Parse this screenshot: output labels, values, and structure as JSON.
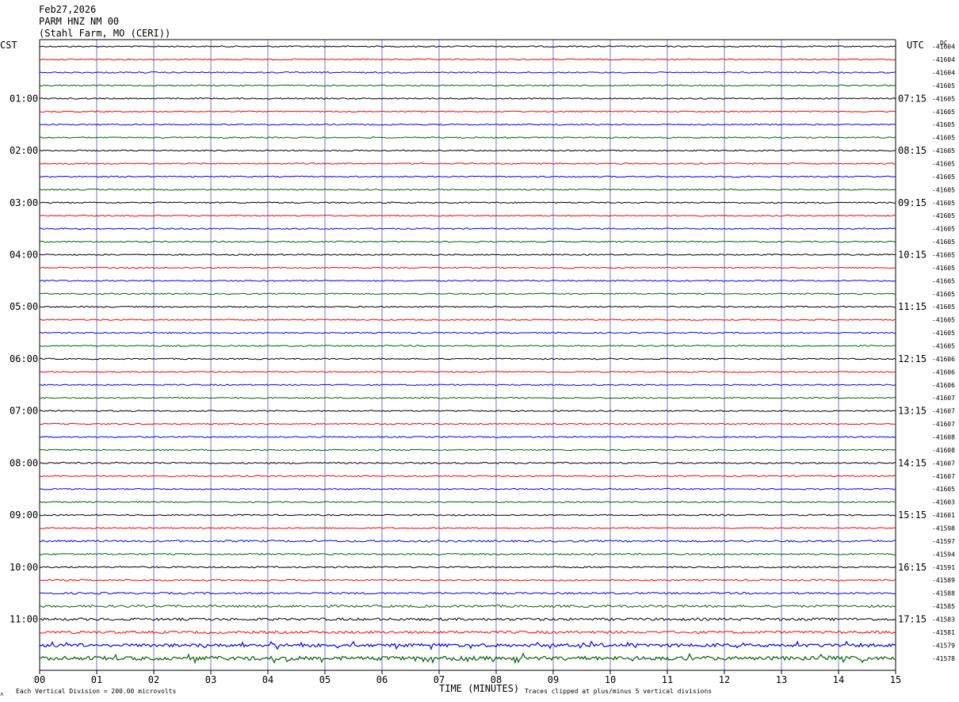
{
  "header": {
    "date": "Feb27,2026",
    "station": "PARM HNZ NM 00",
    "location": "(Stahl Farm, MO (CERI))"
  },
  "left_tz": "CST",
  "right_tz": "UTC",
  "dc_label": "DC",
  "footer": {
    "scale_note": "Each Vertical Division =  200.00 microvolts",
    "xlabel": "TIME (MINUTES)",
    "clip_note": "Traces clipped at plus/minus 5 vertical divisions",
    "corner_mark": "˄"
  },
  "colors": {
    "trace_cycle": [
      "#000000",
      "#ff0000",
      "#0000ff",
      "#006400"
    ],
    "grid_vertical": "#7777bb",
    "frame": "#000000"
  },
  "chart_data": {
    "type": "line",
    "title": "PARM HNZ NM 00",
    "xlabel": "TIME (MINUTES)",
    "xlim": [
      0,
      15
    ],
    "x_ticks": [
      "00",
      "01",
      "02",
      "03",
      "04",
      "05",
      "06",
      "07",
      "08",
      "09",
      "10",
      "11",
      "12",
      "13",
      "14",
      "15"
    ],
    "trace_count": 48,
    "left_hour_labels": [
      "01:00",
      "02:00",
      "03:00",
      "04:00",
      "05:00",
      "06:00",
      "07:00",
      "08:00",
      "09:00",
      "10:00",
      "11:00"
    ],
    "right_hour_labels": [
      "07:15",
      "08:15",
      "09:15",
      "10:15",
      "11:15",
      "12:15",
      "13:15",
      "14:15",
      "15:15",
      "16:15",
      "17:15"
    ],
    "dc_offsets": [
      "-41604",
      "-41604",
      "-41604",
      "-41605",
      "-41605",
      "-41605",
      "-41605",
      "-41605",
      "-41605",
      "-41605",
      "-41605",
      "-41605",
      "-41605",
      "-41605",
      "-41605",
      "-41605",
      "-41605",
      "-41605",
      "-41605",
      "-41605",
      "-41605",
      "-41605",
      "-41605",
      "-41605",
      "-41606",
      "-41606",
      "-41606",
      "-41607",
      "-41607",
      "-41607",
      "-41608",
      "-41608",
      "-41607",
      "-41607",
      "-41605",
      "-41603",
      "-41601",
      "-41598",
      "-41597",
      "-41594",
      "-41591",
      "-41589",
      "-41588",
      "-41585",
      "-41583",
      "-41581",
      "-41579",
      "-41578",
      "-41576",
      "-41572"
    ],
    "trace_amplitude": [
      1,
      1,
      1,
      1,
      1,
      1,
      1,
      1,
      1,
      1,
      1,
      1,
      1,
      1,
      1,
      1,
      1,
      1,
      1,
      1,
      1,
      1,
      1,
      1,
      1,
      1,
      1,
      1,
      1,
      1,
      1,
      1,
      1.2,
      1,
      1,
      1,
      1,
      1,
      1.5,
      1.2,
      1.2,
      1.2,
      1.5,
      1.8,
      2,
      2,
      2.5,
      3,
      5,
      4,
      4
    ]
  }
}
